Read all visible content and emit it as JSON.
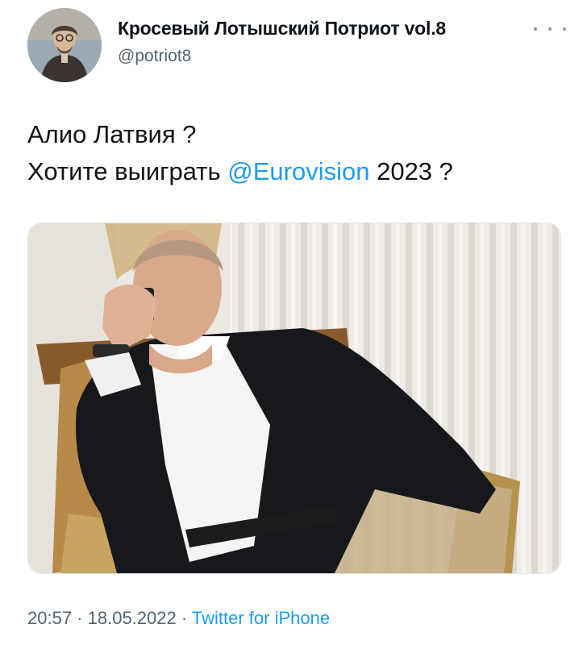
{
  "author": {
    "display_name": "Кросевый Лотышский Потриот vol.8",
    "handle": "@potriot8"
  },
  "tweet": {
    "line1": "Алио Латвия ?",
    "line2_prefix": "Хотите выиграть ",
    "mention": "@Eurovision",
    "line2_suffix": " 2023 ?"
  },
  "media": {
    "description": "photo"
  },
  "footer": {
    "time": "20:57",
    "separator1": " · ",
    "date": "18.05.2022",
    "separator2": " · ",
    "source": "Twitter for iPhone"
  },
  "colors": {
    "accent": "#1d9bf0",
    "secondary_text": "#536471"
  }
}
